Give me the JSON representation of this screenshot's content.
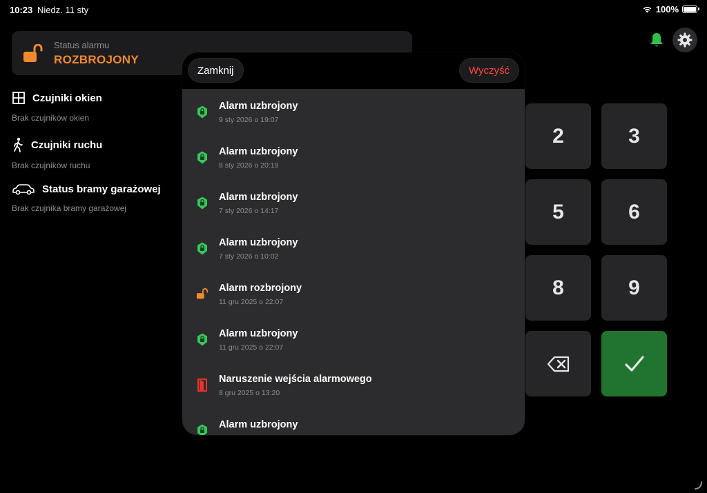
{
  "status_bar": {
    "time": "10:23",
    "date": "Niedz. 11 sty",
    "battery_percent": "100%",
    "battery_level": 1.0
  },
  "alarm_status": {
    "label": "Status alarmu",
    "value": "ROZBROJONY",
    "color": "#f08a2c"
  },
  "sections": [
    {
      "title": "Czujniki okien",
      "subtitle": "Brak czujników okien",
      "icon": "window-icon"
    },
    {
      "title": "Czujniki ruchu",
      "subtitle": "Brak czujników ruchu",
      "icon": "walking-person-icon"
    },
    {
      "title": "Status bramy garażowej",
      "subtitle": "Brak czujnika bramy garażowej",
      "icon": "car-icon"
    }
  ],
  "keypad": {
    "keys": [
      "2",
      "3",
      "5",
      "6",
      "8",
      "9"
    ],
    "delete_icon": "backspace-icon",
    "confirm_icon": "checkmark-icon",
    "confirm_color": "#21742f"
  },
  "modal": {
    "close_label": "Zamknij",
    "clear_label": "Wyczyść",
    "events": [
      {
        "title": "Alarm uzbrojony",
        "time": "9 sty 2026 o 19:07",
        "icon": "shield-lock-icon"
      },
      {
        "title": "Alarm uzbrojony",
        "time": "8 sty 2026 o 20:19",
        "icon": "shield-lock-icon"
      },
      {
        "title": "Alarm uzbrojony",
        "time": "7 sty 2026 o 14:17",
        "icon": "shield-lock-icon"
      },
      {
        "title": "Alarm uzbrojony",
        "time": "7 sty 2026 o 10:02",
        "icon": "shield-lock-icon"
      },
      {
        "title": "Alarm rozbrojony",
        "time": "11 gru 2025 o 22:07",
        "icon": "unlocked-padlock-icon"
      },
      {
        "title": "Alarm uzbrojony",
        "time": "11 gru 2025 o 22:07",
        "icon": "shield-lock-icon"
      },
      {
        "title": "Naruszenie wejścia alarmowego",
        "time": "8 gru 2025 o 13:20",
        "icon": "door-icon"
      },
      {
        "title": "Alarm uzbrojony",
        "time": "",
        "icon": "shield-lock-icon"
      }
    ]
  },
  "colors": {
    "armed_green": "#34c759",
    "disarmed_orange": "#f08a2c",
    "breach_red": "#e8322a",
    "clear_red": "#ff453a",
    "bell_green": "#30c048"
  }
}
